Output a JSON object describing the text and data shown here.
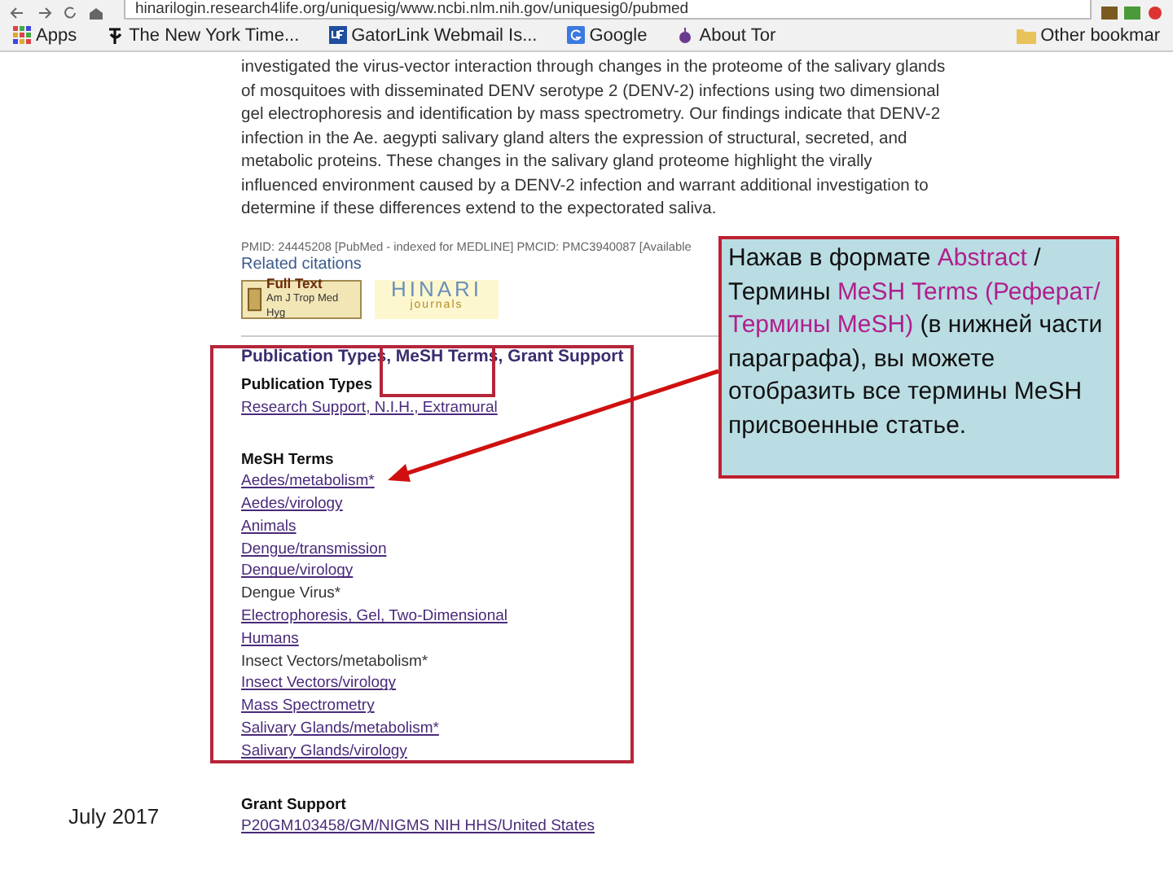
{
  "browser": {
    "address": "hinarilogin.research4life.org/uniquesig/www.ncbi.nlm.nih.gov/uniquesig0/pubmed",
    "bookmarks": [
      {
        "label": "Apps",
        "kind": "apps"
      },
      {
        "label": "The New York Time...",
        "kind": "nyt"
      },
      {
        "label": "GatorLink Webmail Is...",
        "kind": "uf"
      },
      {
        "label": "Google",
        "kind": "google"
      },
      {
        "label": "About Tor",
        "kind": "tor"
      }
    ],
    "other_bookmarks": "Other bookmar"
  },
  "article": {
    "abstract": "investigated the virus-vector interaction through changes in the proteome of the salivary glands of mosquitoes with disseminated DENV serotype 2 (DENV-2) infections using two dimensional gel electrophoresis and identification by mass spectrometry. Our findings indicate that DENV-2 infection in the Ae. aegypti salivary gland alters the expression of structural, secreted, and metabolic proteins. These changes in the salivary gland proteome highlight the virally influenced environment caused by a DENV-2 infection and warrant additional investigation to determine if these differences extend to the expectorated saliva.",
    "pmid_line": "PMID: 24445208 [PubMed - indexed for MEDLINE]   PMCID: PMC3940087 [Available",
    "related": "Related citations",
    "full_text": {
      "title": "Full Text",
      "journal": "Am J Trop Med Hyg"
    },
    "hinari": {
      "title": "HINARI",
      "subtitle": "journals"
    },
    "section_title": "Publication Types, MeSH Terms, Grant Support",
    "publication_types": {
      "heading": "Publication Types",
      "items": [
        {
          "text": "Research Support, N.I.H., Extramural",
          "linked": true
        }
      ]
    },
    "mesh_terms": {
      "heading": "MeSH Terms",
      "items": [
        {
          "text": "Aedes/metabolism*",
          "linked": true
        },
        {
          "text": "Aedes/virology",
          "linked": true
        },
        {
          "text": "Animals",
          "linked": true
        },
        {
          "text": "Dengue/transmission",
          "linked": true
        },
        {
          "text": "Dengue/virology",
          "linked": true
        },
        {
          "text": "Dengue Virus*",
          "linked": false
        },
        {
          "text": "Electrophoresis, Gel, Two-Dimensional",
          "linked": true
        },
        {
          "text": "Humans",
          "linked": true
        },
        {
          "text": "Insect Vectors/metabolism*",
          "linked": false
        },
        {
          "text": "Insect Vectors/virology",
          "linked": true
        },
        {
          "text": "Mass Spectrometry",
          "linked": true
        },
        {
          "text": "Salivary Glands/metabolism*",
          "linked": true
        },
        {
          "text": "Salivary Glands/virology",
          "linked": true
        }
      ]
    },
    "grant_support": {
      "heading": "Grant Support",
      "items": [
        {
          "text": "P20GM103458/GM/NIGMS NIH HHS/United States",
          "linked": true
        }
      ]
    }
  },
  "callout": {
    "segments": [
      {
        "text": "Нажав в формате ",
        "highlight": false
      },
      {
        "text": "Abstract",
        "highlight": true
      },
      {
        "text": " /Термины ",
        "highlight": false
      },
      {
        "text": "MeSH Terms (Реферат/Термины MeSH)",
        "highlight": true
      },
      {
        "text": " (в нижней части параграфа), вы можете отобразить все термины MeSH присвоенные статье.",
        "highlight": false
      }
    ]
  },
  "footer": {
    "date": "July 2017"
  }
}
